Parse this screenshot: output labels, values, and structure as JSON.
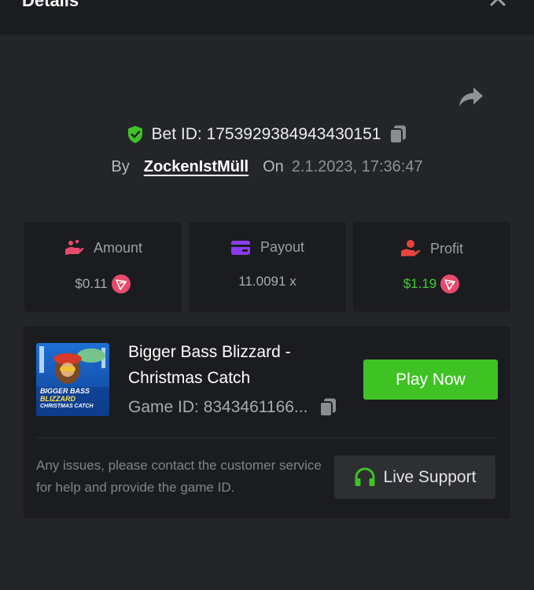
{
  "header": {
    "title": "Details"
  },
  "bet": {
    "id_label": "Bet ID: 1753929384943430151",
    "by_label": "By",
    "username": "ZockenIstMüll",
    "on_label": "On",
    "date": "2.1.2023, 17:36:47"
  },
  "stats": {
    "amount": {
      "label": "Amount",
      "value": "$0.11"
    },
    "payout": {
      "label": "Payout",
      "value": "11.0091 x"
    },
    "profit": {
      "label": "Profit",
      "value": "$1.19"
    }
  },
  "game": {
    "title": "Bigger Bass Blizzard - Christmas Catch",
    "id_label": "Game ID: 8343461166...",
    "thumb_text_1": "BIGGER BASS",
    "thumb_text_2": "BLIZZARD",
    "thumb_text_3": "CHRISTMAS CATCH",
    "play_label": "Play Now"
  },
  "support": {
    "notice": "Any issues, please contact the customer service for help and provide the game ID.",
    "button_label": "Live Support"
  },
  "colors": {
    "accent_green": "#3fc324",
    "profit_green": "#3fcf2f",
    "coin_red": "#e84a6b",
    "card_bg": "#1b1c1f",
    "page_bg": "#232528"
  },
  "icons": {
    "shield": "shield-check-icon",
    "copy": "copy-icon",
    "share": "share-icon",
    "close": "close-icon",
    "amount": "coins-hand-icon",
    "payout": "wallet-card-icon",
    "profit": "profit-hand-icon",
    "coin": "tron-coin-icon",
    "headset": "headset-icon"
  }
}
